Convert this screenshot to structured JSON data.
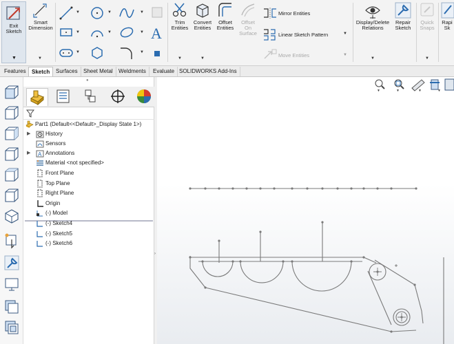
{
  "ribbon": {
    "exit_sketch": "Exit\nSketch",
    "exit_sketch_l1": "Exit",
    "exit_sketch_l2": "Sketch",
    "smart_dimension_l1": "Smart",
    "smart_dimension_l2": "Dimension",
    "trim_l1": "Trim",
    "trim_l2": "Entities",
    "convert_l1": "Convert",
    "convert_l2": "Entities",
    "offset_l1": "Offset",
    "offset_l2": "Entities",
    "offset_surface_l1": "Offset",
    "offset_surface_l2": "On",
    "offset_surface_l3": "Surface",
    "mirror": "Mirror Entities",
    "linear_pattern": "Linear Sketch Pattern",
    "move": "Move Entities",
    "display_delete_l1": "Display/Delete",
    "display_delete_l2": "Relations",
    "repair_l1": "Repair",
    "repair_l2": "Sketch",
    "quick_snaps_l1": "Quick",
    "quick_snaps_l2": "Snaps",
    "rapid_l1": "Rapi",
    "rapid_l2": "Sk"
  },
  "tabs": [
    "Features",
    "Sketch",
    "Surfaces",
    "Sheet Metal",
    "Weldments",
    "Evaluate",
    "SOLIDWORKS Add-Ins"
  ],
  "active_tab": "Sketch",
  "tree": {
    "root": "Part1  (Default<<Default>_Display State 1>)",
    "history": "History",
    "sensors": "Sensors",
    "annotations": "Annotations",
    "material": "Material <not specified>",
    "front_plane": "Front Plane",
    "top_plane": "Top Plane",
    "right_plane": "Right Plane",
    "origin": "Origin",
    "model": "(-) Model",
    "sketch4": "(-) Sketch4",
    "sketch5": "(-) Sketch5",
    "sketch6": "(-) Sketch6"
  },
  "colors": {
    "accent_blue": "#2b6cb0",
    "sketch_line": "#7a7a7a",
    "ribbon_bg": "#f3f3f3"
  }
}
